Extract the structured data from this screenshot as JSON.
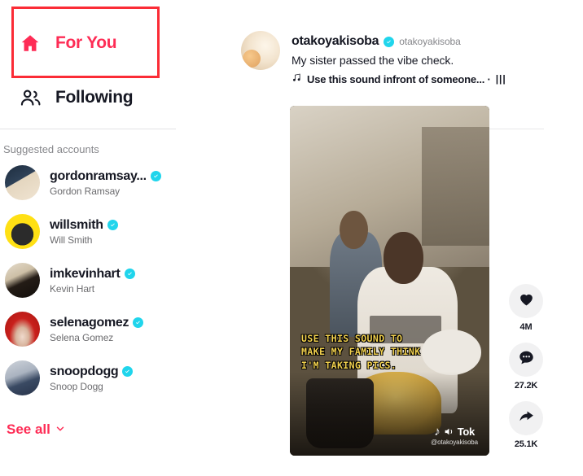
{
  "sidebar": {
    "nav": [
      {
        "id": "for-you",
        "label": "For You",
        "icon": "home-icon",
        "active": true
      },
      {
        "id": "following",
        "label": "Following",
        "icon": "people-icon",
        "active": false
      }
    ],
    "suggested_title": "Suggested accounts",
    "accounts": [
      {
        "handle": "gordonramsay...",
        "name": "Gordon Ramsay",
        "verified": true,
        "avatar_colors": [
          "#243244",
          "#d8c7ad"
        ]
      },
      {
        "handle": "willsmith",
        "name": "Will Smith",
        "verified": true,
        "avatar_colors": [
          "#ffe014",
          "#2b2b2b"
        ]
      },
      {
        "handle": "imkevinhart",
        "name": "Kevin Hart",
        "verified": true,
        "avatar_colors": [
          "#d8cfc0",
          "#2a2420"
        ]
      },
      {
        "handle": "selenagomez",
        "name": "Selena Gomez",
        "verified": true,
        "avatar_colors": [
          "#c9201c",
          "#e8cdbc"
        ]
      },
      {
        "handle": "snoopdogg",
        "name": "Snoop Dogg",
        "verified": true,
        "avatar_colors": [
          "#c9cdd3",
          "#3a4a63"
        ]
      }
    ],
    "see_all_label": "See all",
    "see_all_chevron": "chevron-down-icon"
  },
  "post": {
    "author_handle": "otakoyakisoba",
    "author_nickname": "otakoyakisoba",
    "author_verified": true,
    "caption": "My sister passed the vibe check.",
    "sound_icon": "music-note-icon",
    "sound_label": "Use this sound infront of someone... ·",
    "sound_bars": "|||",
    "video": {
      "overlay_lines": [
        "USE THIS SOUND TO",
        "MAKE MY FAMILY THINK",
        "I'M TAKING PICS."
      ],
      "overlay_color": "#f2d14e",
      "watermark_logo": "♪",
      "watermark_text": "Tok",
      "watermark_user": "@otakoyakisoba"
    },
    "actions": [
      {
        "id": "like",
        "icon": "heart-icon",
        "count": "4M"
      },
      {
        "id": "comment",
        "icon": "comment-icon",
        "count": "27.2K"
      },
      {
        "id": "share",
        "icon": "share-arrow-icon",
        "count": "25.1K"
      }
    ]
  },
  "colors": {
    "accent_red": "#fe2c55",
    "highlight_box": "#fb2c36",
    "verified_blue": "#20d5ec",
    "text_primary": "#161823",
    "text_secondary": "#86878b"
  }
}
